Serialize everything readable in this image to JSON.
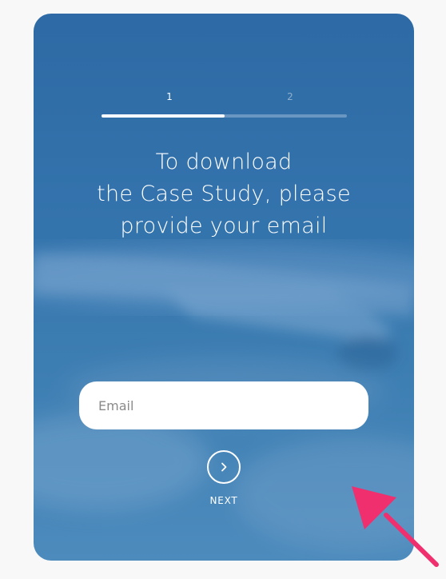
{
  "stepper": {
    "steps": [
      "1",
      "2"
    ],
    "current_step": 1,
    "progress": 0.5
  },
  "heading": {
    "line1": "To download",
    "line2": "the Case Study, please",
    "line3": "provide your email"
  },
  "email": {
    "placeholder": "Email",
    "value": ""
  },
  "next": {
    "label": "NEXT",
    "icon": "chevron-right-icon"
  },
  "colors": {
    "card": "#3272ab",
    "arrow": "#f0306e",
    "page": "#f8f8f8"
  }
}
